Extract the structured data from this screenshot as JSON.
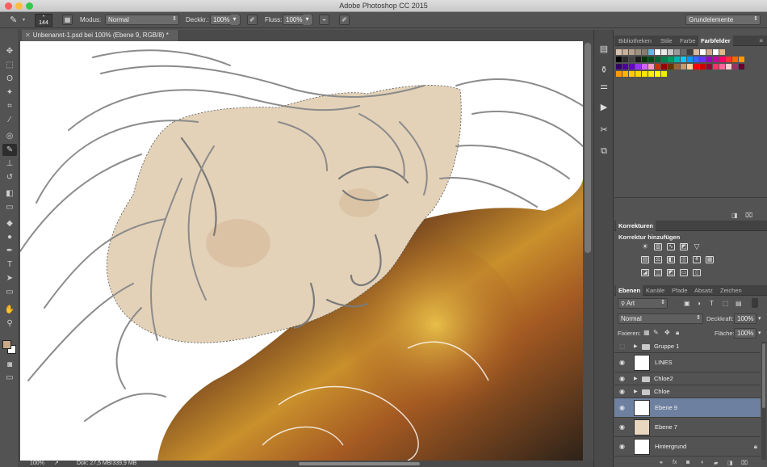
{
  "app": {
    "title": "Adobe Photoshop CC 2015"
  },
  "window_controls": {
    "close_color": "#fc605c",
    "minimize_color": "#fdbc40",
    "zoom_color": "#34c84a"
  },
  "options": {
    "brush_size": "144",
    "mode_label": "Modus:",
    "mode_value": "Normal",
    "opacity_label": "Deckkr.:",
    "opacity_value": "100%",
    "flow_label": "Fluss:",
    "flow_value": "100%",
    "workspace_value": "Grundelemente"
  },
  "document": {
    "tab_title": "Unbenannt-1.psd bei 100% (Ebene 9, RGB/8) *",
    "zoom": "100%",
    "doc_info": "Dok: 27,5 MB/339,9 MB"
  },
  "toolbox": {
    "tools": [
      {
        "name": "move-tool-icon",
        "glyph": "✥"
      },
      {
        "name": "marquee-tool-icon",
        "glyph": "⬚"
      },
      {
        "name": "lasso-tool-icon",
        "glyph": "ʘ"
      },
      {
        "name": "quick-select-tool-icon",
        "glyph": "✦"
      },
      {
        "name": "crop-tool-icon",
        "glyph": "⌗"
      },
      {
        "name": "eyedropper-tool-icon",
        "glyph": "⁄"
      },
      {
        "name": "healing-tool-icon",
        "glyph": "◎"
      },
      {
        "name": "brush-tool-icon",
        "glyph": "✎"
      },
      {
        "name": "stamp-tool-icon",
        "glyph": "⊥"
      },
      {
        "name": "history-brush-tool-icon",
        "glyph": "↺"
      },
      {
        "name": "eraser-tool-icon",
        "glyph": "◧"
      },
      {
        "name": "gradient-tool-icon",
        "glyph": "▭"
      },
      {
        "name": "blur-tool-icon",
        "glyph": "◆"
      },
      {
        "name": "dodge-tool-icon",
        "glyph": "●"
      },
      {
        "name": "pen-tool-icon",
        "glyph": "✒"
      },
      {
        "name": "type-tool-icon",
        "glyph": "T"
      },
      {
        "name": "path-select-tool-icon",
        "glyph": "➤"
      },
      {
        "name": "shape-tool-icon",
        "glyph": "▭"
      },
      {
        "name": "hand-tool-icon",
        "glyph": "✋"
      },
      {
        "name": "zoom-tool-icon",
        "glyph": "⚲"
      }
    ],
    "foreground_color": "#c9a98a",
    "background_color": "#ffffff"
  },
  "panels": {
    "library_tabs": [
      "Bibliotheken",
      "Stile",
      "Farbe",
      "Farbfelder"
    ],
    "corrections_tab": "Korrekturen",
    "corrections_title": "Korrektur hinzufügen",
    "layer_tabs": [
      "Ebenen",
      "Kanäle",
      "Pfade",
      "Absatz",
      "Zeichen"
    ],
    "filter_kind": "Art",
    "blend_mode": "Normal",
    "opacity_label": "Deckkraft:",
    "opacity_value": "100%",
    "lock_label": "Fixieren:",
    "fill_label": "Fläche:",
    "fill_value": "100%"
  },
  "swatches": {
    "row1": [
      "#d8c3b0",
      "#c8b09a",
      "#b5a18e",
      "#a0917f",
      "#8a7d6c",
      "#66b8e4",
      "#ffffff",
      "#e9e9e9",
      "#c9c9c9",
      "#9a9a9a",
      "#6a6a6a",
      "#3e3e3e",
      "#d9b9a0",
      "#ffffff",
      "#d2a88a",
      "#ffffff",
      "#e2b98c"
    ],
    "row2": [
      "#000000",
      "#2b2b2b",
      "#444444",
      "#1a1a1a",
      "#003300",
      "#004d1a",
      "#006633",
      "#00804d",
      "#009966",
      "#00b3b3",
      "#00ccff",
      "#0099ff",
      "#3366ff",
      "#6633ff",
      "#9900cc",
      "#cc0099",
      "#ff0066",
      "#ff3333",
      "#ff6600",
      "#ff9900"
    ],
    "row3": [
      "#330066",
      "#4d0099",
      "#6600cc",
      "#9933ff",
      "#cc66ff",
      "#ff99cc",
      "#cc3300",
      "#990000",
      "#663300",
      "#996633",
      "#cc9966",
      "#ffcc99",
      "#ff0000",
      "#cc0000",
      "#990033",
      "#ff3366",
      "#ff6699",
      "#ffcccc",
      "#993366",
      "#660033"
    ],
    "row4": [
      "#ff9900",
      "#ffb300",
      "#ffcc00",
      "#ffd900",
      "#ffe600",
      "#fff200",
      "#ffff00",
      "#eeee00"
    ]
  },
  "layers": [
    {
      "name": "Gruppe 1",
      "type": "group",
      "visible": false
    },
    {
      "name": "LINES",
      "type": "layer",
      "visible": true
    },
    {
      "name": "Chloe2",
      "type": "group",
      "visible": true
    },
    {
      "name": "Chloe",
      "type": "group",
      "visible": true
    },
    {
      "name": "Ebene 9",
      "type": "layer",
      "visible": true,
      "selected": true
    },
    {
      "name": "Ebene 7",
      "type": "layer",
      "visible": true
    },
    {
      "name": "Hintergrund",
      "type": "layer",
      "visible": true,
      "locked": true
    }
  ]
}
